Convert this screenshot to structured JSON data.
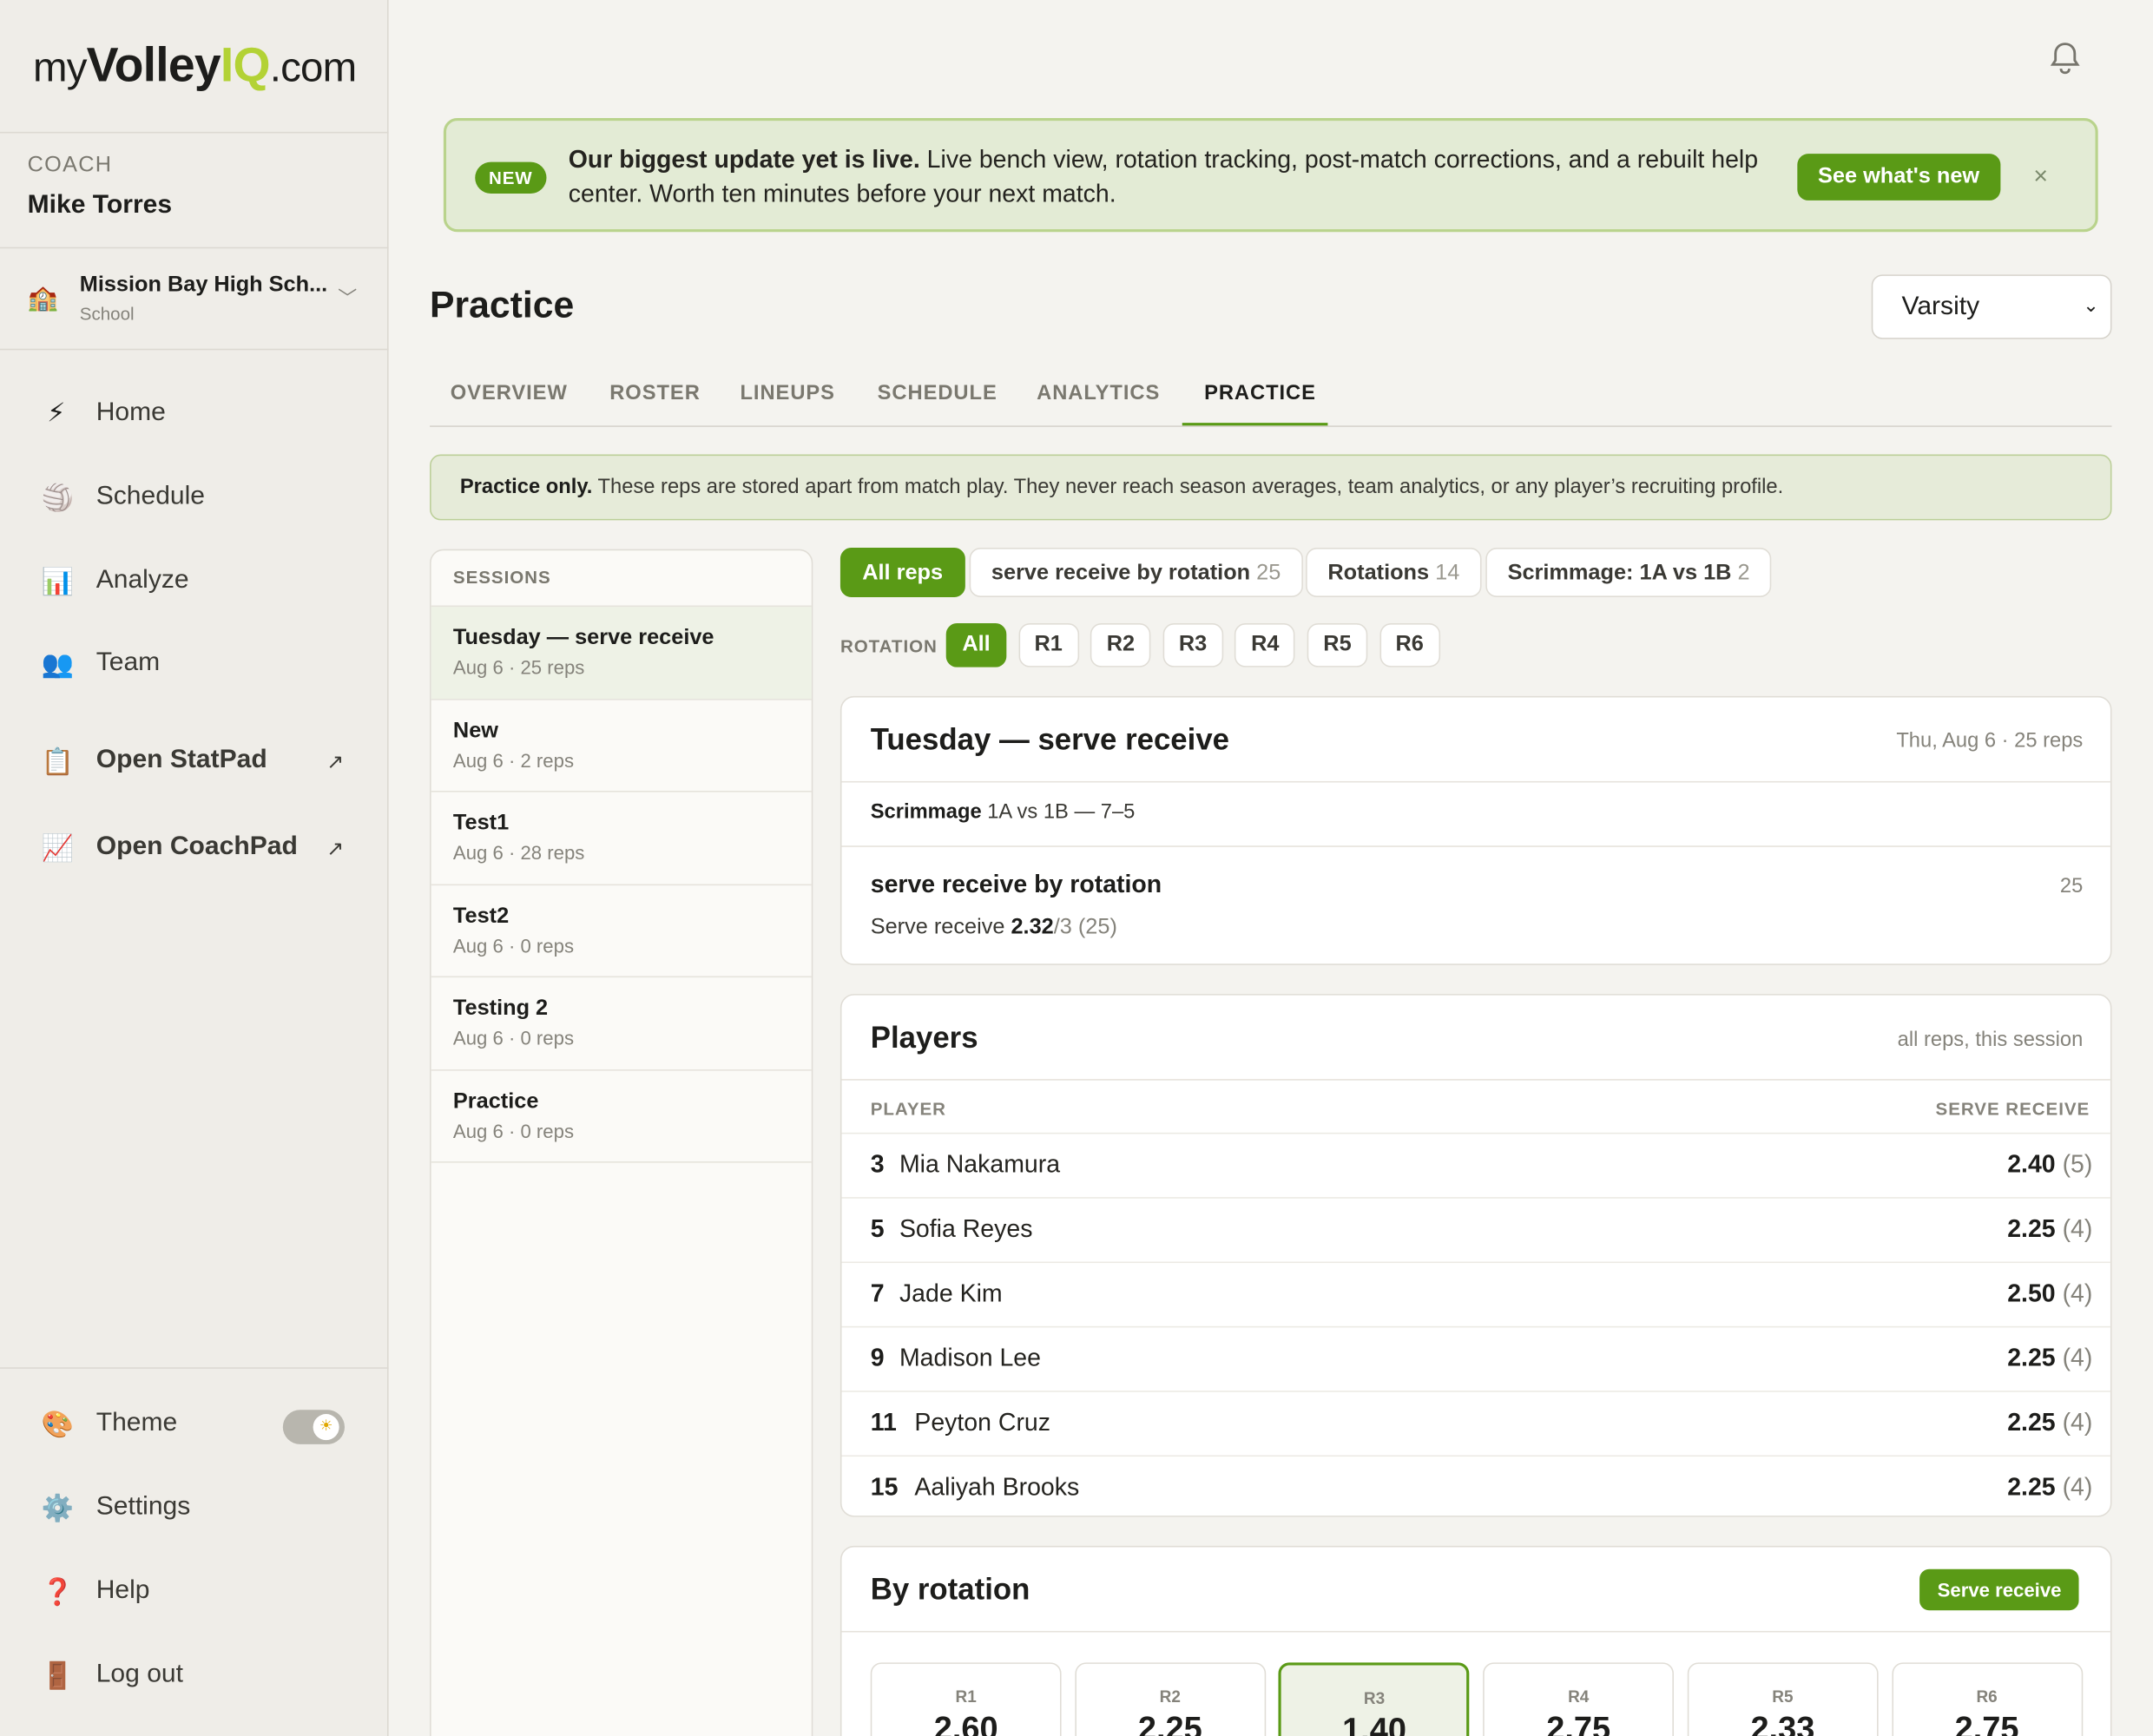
{
  "logo": {
    "my": "my",
    "volley": "Volley",
    "iq": "IQ",
    "com": ".com"
  },
  "coach": {
    "role": "COACH",
    "name": "Mike Torres"
  },
  "school": {
    "name": "Mission Bay High Sch...",
    "type": "School"
  },
  "nav": [
    {
      "label": "Home",
      "icon": "lightning-icon",
      "glyph": "⚡"
    },
    {
      "label": "Schedule",
      "icon": "volleyball-icon",
      "glyph": "🏐"
    },
    {
      "label": "Analyze",
      "icon": "bar-chart-icon",
      "glyph": "📊"
    },
    {
      "label": "Team",
      "icon": "team-icon",
      "glyph": "👥"
    }
  ],
  "external": [
    {
      "label": "Open StatPad",
      "icon": "clipboard-icon",
      "glyph": "📋",
      "arrow": "↗"
    },
    {
      "label": "Open CoachPad",
      "icon": "trend-chart-icon",
      "glyph": "📈",
      "arrow": "↗"
    }
  ],
  "bottom_nav": [
    {
      "label": "Theme",
      "icon": "palette-icon",
      "glyph": "🎨"
    },
    {
      "label": "Settings",
      "icon": "gear-icon",
      "glyph": "⚙️"
    },
    {
      "label": "Help",
      "icon": "question-icon",
      "glyph": "❓"
    },
    {
      "label": "Log out",
      "icon": "door-icon",
      "glyph": "🚪"
    }
  ],
  "theme_toggle": {
    "state": "light",
    "glyph": "☀"
  },
  "banner": {
    "badge": "NEW",
    "headline": "Our biggest update yet is live.",
    "body": " Live bench view, rotation tracking, post-match corrections, and a rebuilt help center. Worth ten minutes before your next match.",
    "button": "See what's new",
    "close": "×"
  },
  "page": {
    "title": "Practice",
    "team_select": "Varsity"
  },
  "tabs": [
    "OVERVIEW",
    "ROSTER",
    "LINEUPS",
    "SCHEDULE",
    "ANALYTICS",
    "PRACTICE"
  ],
  "active_tab": "PRACTICE",
  "notice": {
    "bold": "Practice only.",
    "text": " These reps are stored apart from match play. They never reach season averages, team analytics, or any player’s recruiting profile."
  },
  "sessions": {
    "header": "SESSIONS",
    "items": [
      {
        "name": "Tuesday — serve receive",
        "meta": "Aug 6 · 25 reps"
      },
      {
        "name": "New",
        "meta": "Aug 6 · 2 reps"
      },
      {
        "name": "Test1",
        "meta": "Aug 6 · 28 reps"
      },
      {
        "name": "Test2",
        "meta": "Aug 6 · 0 reps"
      },
      {
        "name": "Testing 2",
        "meta": "Aug 6 · 0 reps"
      },
      {
        "name": "Practice",
        "meta": "Aug 6 · 0 reps"
      }
    ]
  },
  "filters": [
    {
      "label": "All reps",
      "count": ""
    },
    {
      "label": "serve receive by rotation",
      "count": "25"
    },
    {
      "label": "Rotations",
      "count": "14"
    },
    {
      "label": "Scrimmage: 1A vs 1B",
      "count": "2"
    }
  ],
  "rotation_filter": {
    "label": "ROTATION",
    "options": [
      "All",
      "R1",
      "R2",
      "R3",
      "R4",
      "R5",
      "R6"
    ]
  },
  "session_card": {
    "title": "Tuesday — serve receive",
    "meta": "Thu, Aug 6 · 25 reps",
    "scrimmage_label": "Scrimmage",
    "scrimmage_text": " 1A vs 1B — 7–5",
    "drill": "serve receive by rotation",
    "drill_count": "25",
    "stat_label": "Serve receive ",
    "stat_value": "2.32",
    "stat_suffix": "/3 (25)"
  },
  "players_card": {
    "title": "Players",
    "meta": "all reps, this session",
    "col_player": "PLAYER",
    "col_stat": "SERVE RECEIVE",
    "rows": [
      {
        "num": "3",
        "name": "Mia Nakamura",
        "value": "2.40",
        "count": "(5)"
      },
      {
        "num": "5",
        "name": "Sofia Reyes",
        "value": "2.25",
        "count": "(4)"
      },
      {
        "num": "7",
        "name": "Jade Kim",
        "value": "2.50",
        "count": "(4)"
      },
      {
        "num": "9",
        "name": "Madison Lee",
        "value": "2.25",
        "count": "(4)"
      },
      {
        "num": "11",
        "name": "Peyton Cruz",
        "value": "2.25",
        "count": "(4)"
      },
      {
        "num": "15",
        "name": "Aaliyah Brooks",
        "value": "2.25",
        "count": "(4)"
      }
    ]
  },
  "rotation_card": {
    "title": "By rotation",
    "button": "Serve receive",
    "items": [
      {
        "label": "R1",
        "value": "2.60"
      },
      {
        "label": "R2",
        "value": "2.25"
      },
      {
        "label": "R3",
        "value": "1.40",
        "highlight": true
      },
      {
        "label": "R4",
        "value": "2.75"
      },
      {
        "label": "R5",
        "value": "2.33"
      },
      {
        "label": "R6",
        "value": "2.75"
      }
    ]
  },
  "colors": {
    "accent": "#5a9a16",
    "logo_accent": "#b3d235",
    "banner_bg": "#e3ebd5"
  }
}
